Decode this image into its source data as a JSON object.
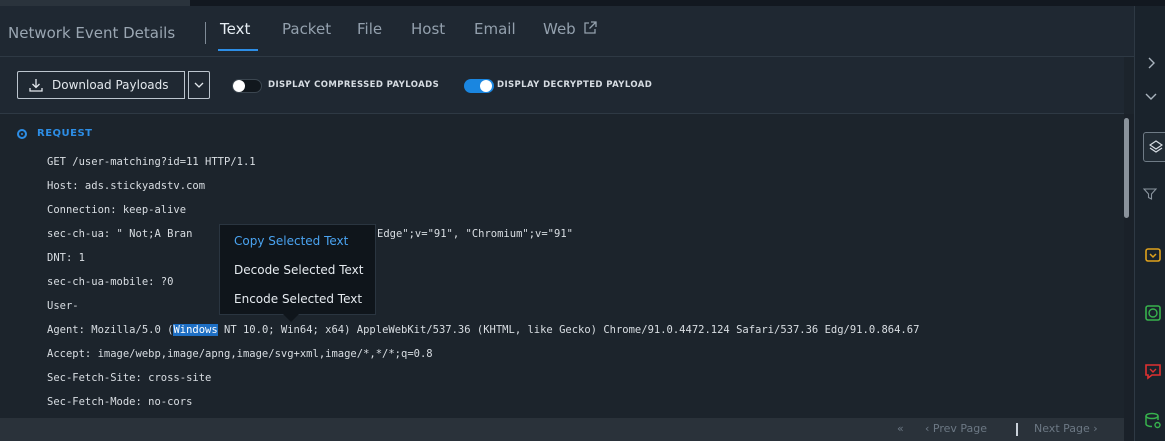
{
  "header": {
    "title": "Network Event Details",
    "tabs": [
      {
        "label": "Text",
        "active": true
      },
      {
        "label": "Packet",
        "active": false
      },
      {
        "label": "File",
        "active": false
      },
      {
        "label": "Host",
        "active": false
      },
      {
        "label": "Email",
        "active": false
      },
      {
        "label": "Web",
        "active": false,
        "icon": "external-link-icon"
      }
    ]
  },
  "toolbar": {
    "download_label": "Download Payloads",
    "compressed_label": "DISPLAY COMPRESSED PAYLOADS",
    "compressed_on": false,
    "decrypted_label": "DISPLAY DECRYPTED PAYLOAD",
    "decrypted_on": true
  },
  "request": {
    "label": "REQUEST",
    "lines": [
      "GET /user-matching?id=11 HTTP/1.1",
      "Host: ads.stickyadstv.com",
      "Connection: keep-alive",
      "sec-ch-ua: \" Not;A Bran",
      "DNT: 1",
      "sec-ch-ua-mobile: ?0",
      "User-",
      "Agent: Mozilla/5.0 (",
      "Accept: image/webp,image/apng,image/svg+xml,image/*,*/*;q=0.8",
      "Sec-Fetch-Site: cross-site",
      "Sec-Fetch-Mode: no-cors"
    ],
    "line4_tail": "Edge\";v=\"91\", \"Chromium\";v=\"91\"",
    "agent_selected": "Windows",
    "agent_rest": " NT 10.0; Win64; x64) AppleWebKit/537.36 (KHTML, like Gecko) Chrome/91.0.4472.124 Safari/537.36 Edg/91.0.864.67"
  },
  "context_menu": {
    "items": [
      {
        "label": "Copy Selected Text",
        "active": true
      },
      {
        "label": "Decode Selected Text",
        "active": false
      },
      {
        "label": "Encode Selected Text",
        "active": false
      }
    ]
  },
  "pager": {
    "first": "«",
    "prev": "‹ Prev Page",
    "next": "Next Page ›"
  },
  "colors": {
    "accent": "#2d8ee6",
    "background": "#1c242c",
    "selection": "#1e6fc4"
  }
}
